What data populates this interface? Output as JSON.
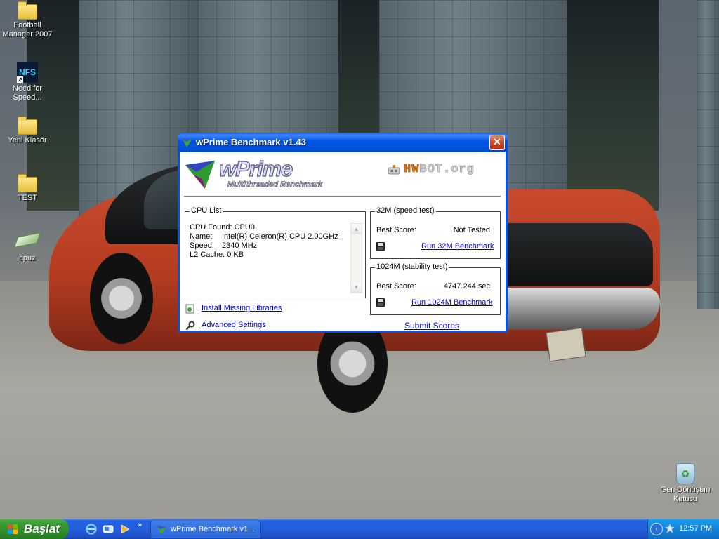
{
  "desktop": {
    "icons": [
      {
        "label": "Football Manager 2007"
      },
      {
        "label": "Need for Speed...",
        "badge": "NFS"
      },
      {
        "label": "Yeni Klasör"
      },
      {
        "label": "TEST"
      },
      {
        "label": "cpuz"
      },
      {
        "label": "Geri Dönüşüm Kutusu"
      }
    ]
  },
  "window": {
    "title": "wPrime Benchmark v1.43",
    "close_label": "✕",
    "logo": {
      "word": "wPrime",
      "subtitle": "Multithreaded Benchmark",
      "partner_a": "HW",
      "partner_b": "BOT.org"
    },
    "cpu_list": {
      "title": "CPU List",
      "found": "CPU Found: CPU0",
      "name_key": "Name:",
      "name_value": "Intel(R) Celeron(R) CPU 2.00GHz",
      "speed_key": "Speed:",
      "speed_value": "2340 MHz",
      "cache": "L2 Cache: 0 KB"
    },
    "bench32": {
      "title": "32M (speed test)",
      "best_label": "Best Score:",
      "best_value": "Not Tested",
      "run_label": "Run 32M Benchmark"
    },
    "bench1024": {
      "title": "1024M (stability test)",
      "best_label": "Best Score:",
      "best_value": "4747.244 sec",
      "run_label": "Run 1024M Benchmark"
    },
    "install_label": "Install Missing Libraries",
    "advanced_label": "Advanced Settings",
    "submit_label": "Submit Scores"
  },
  "taskbar": {
    "start_label": "Başlat",
    "quicklaunch_more": "»",
    "task_label": "wPrime Benchmark v1...",
    "tray_toggle": "‹",
    "clock": "12:57 PM"
  },
  "colors": {
    "title_blue": "#0054e3",
    "start_green": "#2e8a2a",
    "link_blue": "#0000cc",
    "hwbot_accent": "#e07b1f"
  },
  "icons": [
    "folder-icon",
    "nfs-shortcut-icon",
    "cpuz-icon",
    "recycle-bin-icon",
    "wprime-icon",
    "hwbot-icon",
    "floppy-disk-icon",
    "install-icon",
    "wrench-icon",
    "windows-flag-icon",
    "ie-icon",
    "show-desktop-icon",
    "media-icon",
    "tray-network-icon"
  ]
}
